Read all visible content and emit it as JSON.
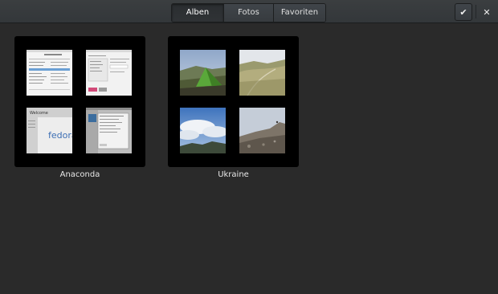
{
  "header": {
    "tabs": [
      {
        "label": "Alben",
        "active": true
      },
      {
        "label": "Fotos",
        "active": false
      },
      {
        "label": "Favoriten",
        "active": false
      }
    ],
    "select_icon": "checkmark-icon",
    "close_icon": "close-icon"
  },
  "collections": [
    {
      "name": "Anaconda",
      "thumbnails": [
        "installer-screenshot",
        "installer-screenshot",
        "fedora-welcome-screenshot",
        "installer-screenshot"
      ]
    },
    {
      "name": "Ukraine",
      "thumbnails": [
        "tent-on-hillside-photo",
        "mountain-ridge-photo",
        "clouds-over-mountains-photo",
        "rocky-summit-photo"
      ]
    }
  ],
  "thumbnail_text": {
    "fedora_logo": "fedora",
    "welcome_heading": "Welcome"
  },
  "colors": {
    "background": "#2a2a2a",
    "headerbar": "#383b3e",
    "fedora_blue": "#3c6eb4"
  }
}
